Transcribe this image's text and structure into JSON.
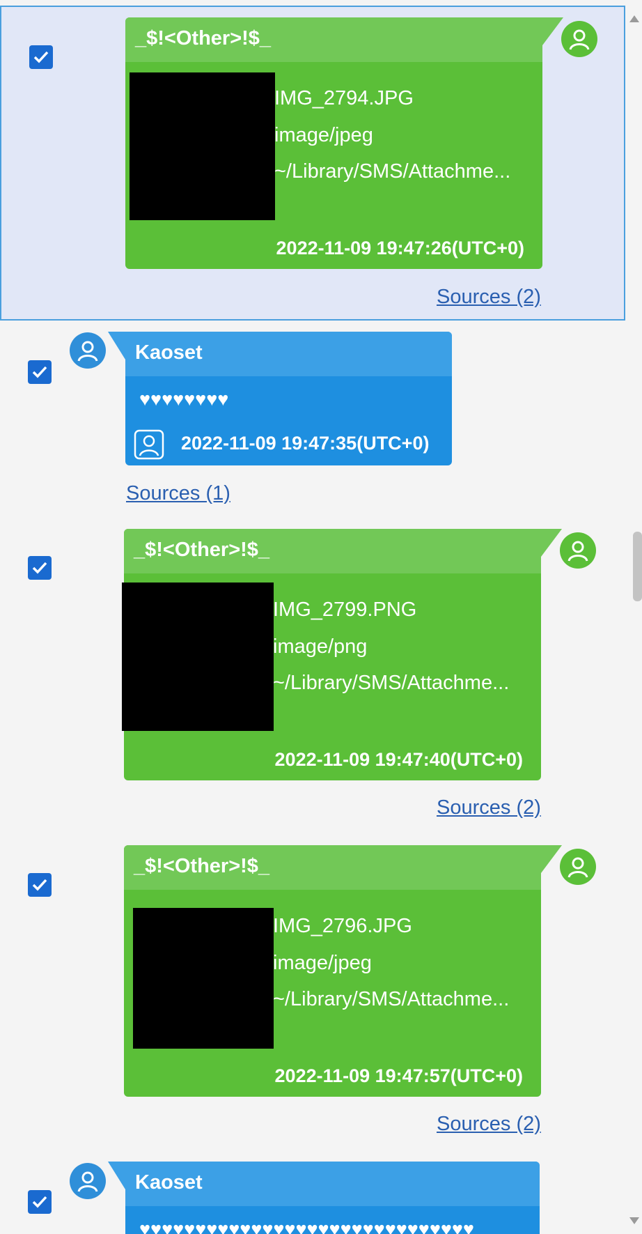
{
  "messages": [
    {
      "sender": "_$!<Other>!$_",
      "file_name": "IMG_2794.JPG",
      "mime_type": "image/jpeg",
      "path": "~/Library/SMS/Attachme...",
      "timestamp": "2022-11-09 19:47:26(UTC+0)",
      "sources": "Sources (2)"
    },
    {
      "sender": "Kaoset",
      "text": "♥♥♥♥♥♥♥♥",
      "timestamp": "2022-11-09 19:47:35(UTC+0)",
      "sources": "Sources (1)"
    },
    {
      "sender": "_$!<Other>!$_",
      "file_name": "IMG_2799.PNG",
      "mime_type": "image/png",
      "path": "~/Library/SMS/Attachme...",
      "timestamp": "2022-11-09 19:47:40(UTC+0)",
      "sources": "Sources (2)"
    },
    {
      "sender": "_$!<Other>!$_",
      "file_name": "IMG_2796.JPG",
      "mime_type": "image/jpeg",
      "path": "~/Library/SMS/Attachme...",
      "timestamp": "2022-11-09 19:47:57(UTC+0)",
      "sources": "Sources (2)"
    },
    {
      "sender": "Kaoset",
      "text": "♥♥♥♥♥♥♥♥♥♥♥♥♥♥♥♥♥♥♥♥♥♥♥♥♥♥♥♥♥♥"
    }
  ],
  "colors": {
    "outgoing_bubble": "#5bbf38",
    "outgoing_header": "#72c857",
    "incoming_bubble": "#1e8fe0",
    "incoming_header": "#3ca0e6",
    "checkbox": "#1a6ad0",
    "link": "#2a5fb0",
    "selection": "#e1e7f7"
  },
  "icons": {
    "avatar": "user-avatar-icon",
    "group": "group-contact-icon",
    "check": "checkmark-icon"
  }
}
